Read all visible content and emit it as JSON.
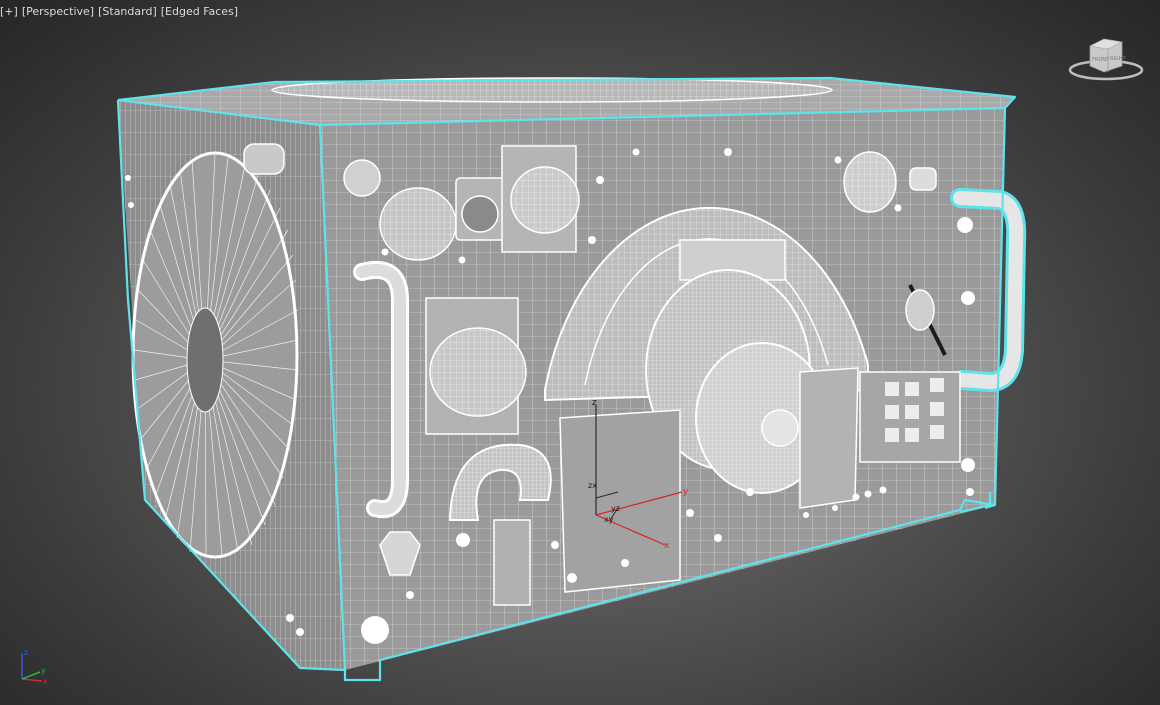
{
  "viewport": {
    "menu": {
      "plus": "[+]",
      "view": "[Perspective]",
      "shading": "[Standard]",
      "display": "[Edged Faces]"
    }
  },
  "viewcube": {
    "face_front": "FRONT",
    "face_right": "RIGHT"
  },
  "gizmo": {
    "x": "x",
    "y": "y",
    "z": "z",
    "xy": "xy",
    "yz": "yz",
    "zx": "zx"
  },
  "axis_tripod": {
    "x": "x",
    "y": "y",
    "z": "z"
  },
  "colors": {
    "selection_outline": "#5fe3ea",
    "wire": "#ffffff",
    "background": "#4a4a4a",
    "gizmo_x": "#d62424",
    "gizmo_y": "#d62424",
    "gizmo_z": "#2a2a2a"
  }
}
